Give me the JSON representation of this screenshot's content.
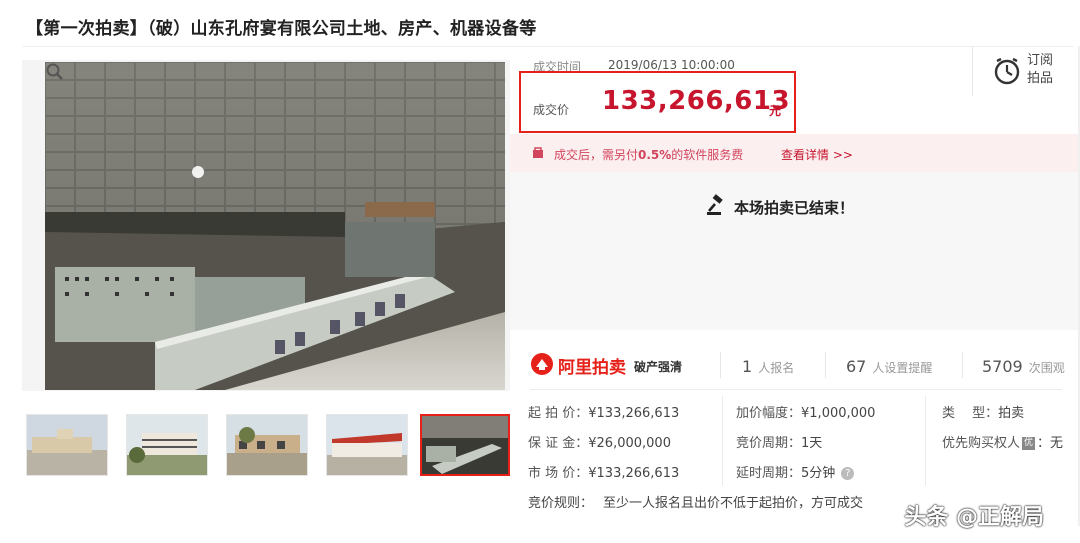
{
  "page": {
    "title": "【第一次拍卖】（破）山东孔府宴有限公司土地、房产、机器设备等"
  },
  "deal": {
    "time_label": "成交时间",
    "time_value": "2019/06/13 10:00:00",
    "price_label": "成交价",
    "price_value": "133,266,613",
    "price_unit": "元"
  },
  "subscribe": {
    "label": "订阅拍品",
    "icon": "clock-icon"
  },
  "fee": {
    "text_prefix": "成交后，需另付",
    "rate": "0.5%",
    "text_suffix": "的软件服务费",
    "link": "查看详情 >>"
  },
  "status": {
    "ended_text": "本场拍卖已结束！"
  },
  "brand": {
    "name": "阿里拍卖",
    "tag": "破产强清"
  },
  "stats": [
    {
      "num": "1",
      "label": "人报名"
    },
    {
      "num": "67",
      "label": "人设置提醒"
    },
    {
      "num": "5709",
      "label": "次围观"
    }
  ],
  "info": {
    "start_price_label": "起 拍 价：",
    "start_price_value": "¥133,266,613",
    "deposit_label": "保 证 金：",
    "deposit_value": "¥26,000,000",
    "market_price_label": "市 场 价：",
    "market_price_value": "¥133,266,613",
    "increment_label": "加价幅度：",
    "increment_value": "¥1,000,000",
    "cycle_label": "竞价周期：",
    "cycle_value": "1天",
    "delay_label": "延时周期：",
    "delay_value": "5分钟",
    "type_label": "类　 型：",
    "type_value": "拍卖",
    "priority_label": "优先购买权人",
    "priority_icon_text": "优",
    "priority_value": "：无",
    "rules_label": "竞价规则：",
    "rules_value": "至少一人报名且出价不低于起拍价，方可成交"
  },
  "watermark": "头条 @正解局",
  "colors": {
    "accent": "#c7152e",
    "highlight_box": "#e5211a",
    "fee_bg": "#fbeff0"
  }
}
